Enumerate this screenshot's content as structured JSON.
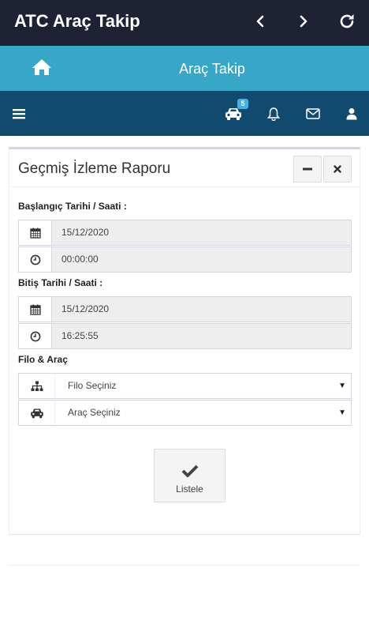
{
  "appbar": {
    "title": "ATC Araç Takip",
    "back_icon": "chevron-left-icon",
    "forward_icon": "chevron-right-icon",
    "refresh_icon": "refresh-icon"
  },
  "header": {
    "home_icon": "home-icon",
    "title": "Araç Takip"
  },
  "toolbar": {
    "menu_icon": "hamburger-icon",
    "car_icon": "car-icon",
    "car_badge": "5",
    "bell_icon": "bell-icon",
    "mail_icon": "envelope-icon",
    "user_icon": "user-icon"
  },
  "report": {
    "title": "Geçmiş İzleme Raporu",
    "minimize_icon": "minus-icon",
    "close_icon": "close-icon",
    "start_label": "Başlangıç Tarihi / Saati :",
    "start_date": "15/12/2020",
    "start_time": "00:00:00",
    "end_label": "Bitiş Tarihi / Saati :",
    "end_date": "15/12/2020",
    "end_time": "16:25:55",
    "fleet_label": "Filo & Araç",
    "fleet_select": "Filo Seçiniz",
    "vehicle_select": "Araç Seçiniz",
    "list_button": "Listele"
  },
  "colors": {
    "appbar": "#1f2135",
    "header": "#37a7c7",
    "toolbar": "#12496e",
    "badge": "#3fb3e8"
  }
}
